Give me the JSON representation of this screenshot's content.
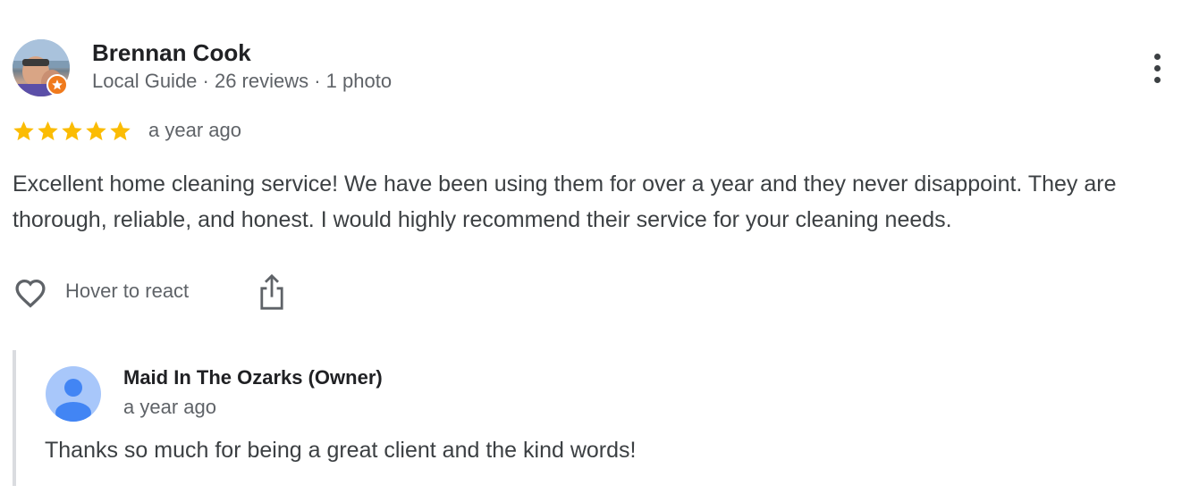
{
  "review": {
    "author": {
      "name": "Brennan Cook",
      "meta": "Local Guide · 26 reviews · 1 photo",
      "badge_icon": "local-guide-star-icon"
    },
    "rating": 5,
    "rating_max": 5,
    "time": "a year ago",
    "text": "Excellent home cleaning service! We have been using them for over a year and they never disappoint. They are thorough, reliable, and honest. I would highly recommend their service for your cleaning needs.",
    "actions": {
      "react_label": "Hover to react",
      "react_icon": "heart-icon",
      "share_icon": "share-icon",
      "more_icon": "more-vert-icon"
    }
  },
  "owner_reply": {
    "name": "Maid In The Ozarks (Owner)",
    "time": "a year ago",
    "text": "Thanks so much for being a great client and the kind words!",
    "avatar_icon": "default-avatar-icon"
  },
  "colors": {
    "star": "#fbbc04",
    "badge": "#f07a1c",
    "text_primary": "#202124",
    "text_secondary": "#5f6368",
    "owner_avatar_bg": "#a8c7fa",
    "owner_avatar_fg": "#4285f4"
  }
}
